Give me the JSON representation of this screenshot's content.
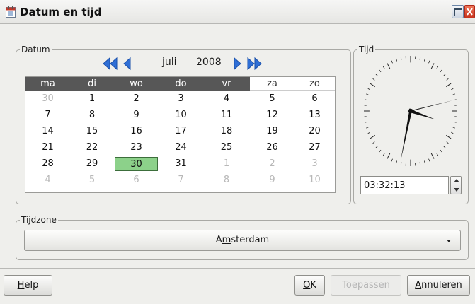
{
  "window": {
    "title": "Datum en tijd",
    "icon": "calendar-app-icon"
  },
  "datum": {
    "legend": "Datum",
    "month": "juli",
    "year": "2008",
    "weekdays": [
      "ma",
      "di",
      "wo",
      "do",
      "vr",
      "za",
      "zo"
    ],
    "weeks": [
      [
        "30",
        "1",
        "2",
        "3",
        "4",
        "5",
        "6"
      ],
      [
        "7",
        "8",
        "9",
        "10",
        "11",
        "12",
        "13"
      ],
      [
        "14",
        "15",
        "16",
        "17",
        "18",
        "19",
        "20"
      ],
      [
        "21",
        "22",
        "23",
        "24",
        "25",
        "26",
        "27"
      ],
      [
        "28",
        "29",
        "30",
        "31",
        "1",
        "2",
        "3"
      ],
      [
        "4",
        "5",
        "6",
        "7",
        "8",
        "9",
        "10"
      ]
    ],
    "selected_day": "30",
    "colors": {
      "header_bg": "#575757",
      "selected_bg": "#8cd18a",
      "nav_arrow": "#2f6fd6"
    }
  },
  "tijd": {
    "legend": "Tijd",
    "time": "03:32:13",
    "hour": 3,
    "minute": 32,
    "second": 13
  },
  "tijdzone": {
    "legend": "Tijdzone",
    "value_pre": "A",
    "value_mn": "m",
    "value_post": "sterdam"
  },
  "buttons": {
    "help_mn": "H",
    "help_rest": "elp",
    "ok_mn": "O",
    "ok_rest": "K",
    "apply": "Toepassen",
    "cancel_mn": "A",
    "cancel_rest": "nnuleren"
  }
}
